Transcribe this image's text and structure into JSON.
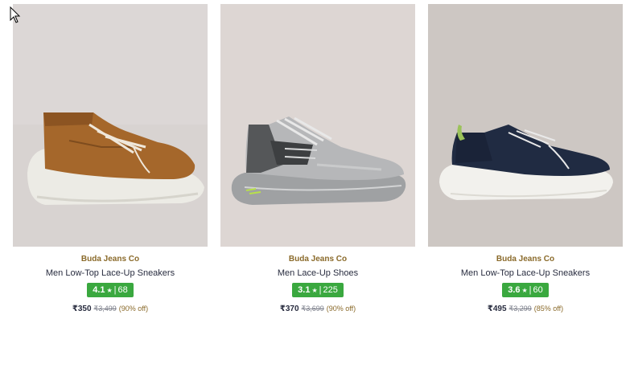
{
  "products": [
    {
      "brand": "Buda Jeans Co",
      "title": "Men Low-Top Lace-Up Sneakers",
      "rating": "4.1",
      "rating_count": "68",
      "price": "₹350",
      "mrp": "₹3,499",
      "discount": "(90% off)",
      "image_bg": "#d6d1cf",
      "shoe_color": "#a0642a"
    },
    {
      "brand": "Buda Jeans Co",
      "title": "Men Lace-Up Shoes",
      "rating": "3.1",
      "rating_count": "225",
      "price": "₹370",
      "mrp": "₹3,699",
      "discount": "(90% off)",
      "image_bg": "#ddd6d3",
      "shoe_color": "#a8a9ab"
    },
    {
      "brand": "Buda Jeans Co",
      "title": "Men Low-Top Lace-Up Sneakers",
      "rating": "3.6",
      "rating_count": "60",
      "price": "₹495",
      "mrp": "₹3,299",
      "discount": "(85% off)",
      "image_bg": "#cdc7c3",
      "shoe_color": "#1f2a40"
    }
  ],
  "rating_star": "★",
  "rating_separator": "|",
  "colors": {
    "rating_badge": "#3aa83f",
    "brand_text": "#8a6a2a"
  }
}
